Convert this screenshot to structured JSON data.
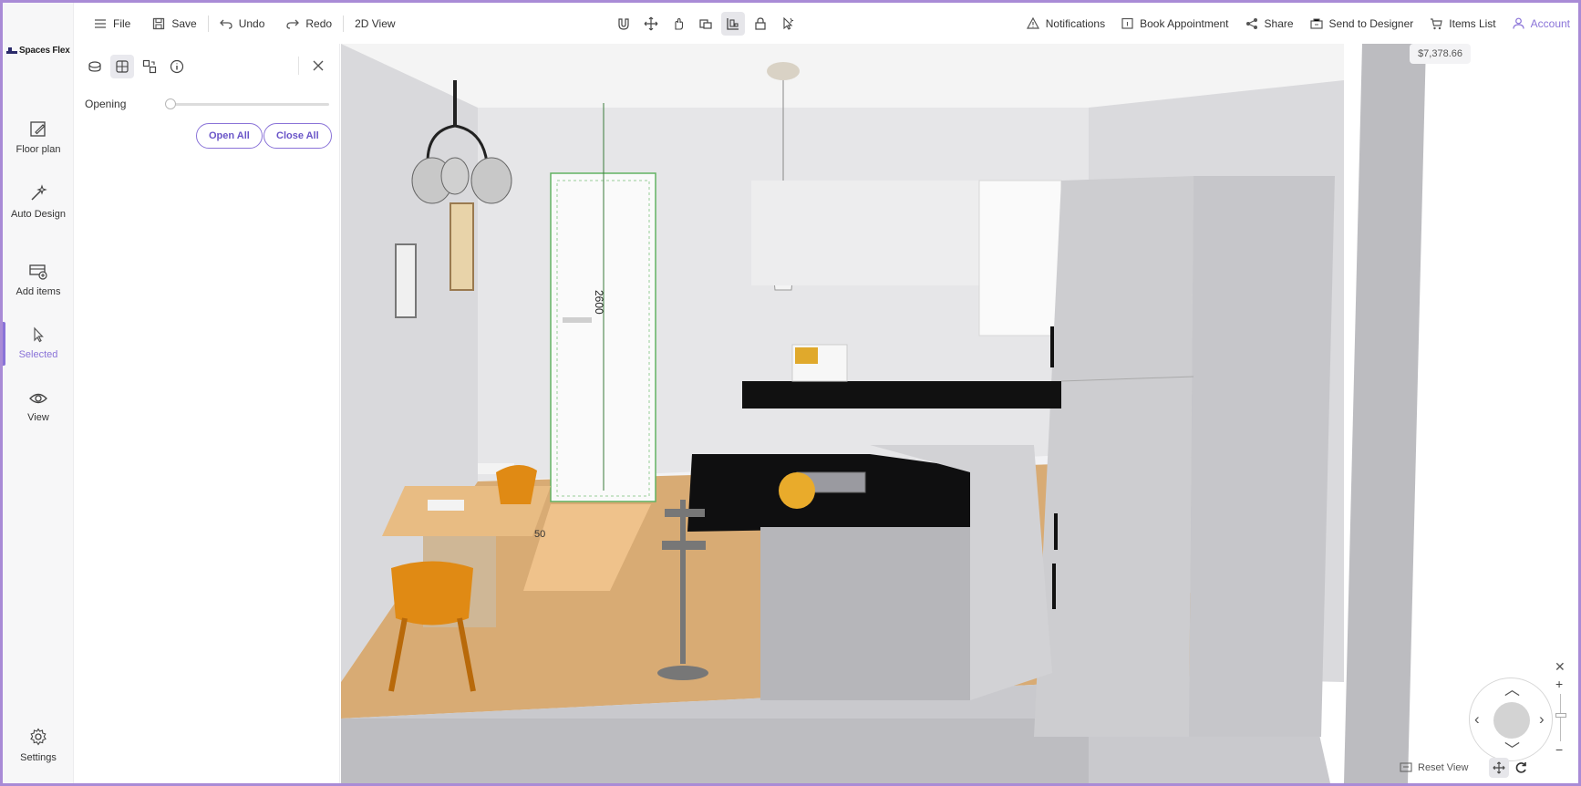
{
  "brand": {
    "name": "Spaces Flex"
  },
  "toolbar": {
    "file": "File",
    "save": "Save",
    "undo": "Undo",
    "redo": "Redo",
    "view_2d": "2D View",
    "notifications": "Notifications",
    "book_appointment": "Book Appointment",
    "share": "Share",
    "send_to_designer": "Send to Designer",
    "items_list": "Items List",
    "account": "Account"
  },
  "sidebar": {
    "items": [
      {
        "label": "Floor plan",
        "icon": "floor-plan-icon"
      },
      {
        "label": "Auto Design",
        "icon": "magic-wand-icon"
      },
      {
        "label": "Add items",
        "icon": "add-items-icon"
      },
      {
        "label": "Selected",
        "icon": "cursor-icon",
        "active": true
      },
      {
        "label": "View",
        "icon": "eye-icon"
      }
    ],
    "settings": "Settings"
  },
  "panel": {
    "opening_label": "Opening",
    "opening_value": 0,
    "open_all": "Open All",
    "close_all": "Close All"
  },
  "viewport": {
    "price": "$7,378.66",
    "dimension_height": "2600",
    "dimension_width": "50",
    "reset_view": "Reset View"
  },
  "colors": {
    "accent": "#8a73d8",
    "border": "#a98bd6",
    "countertop": "#111111",
    "floor": "#d6a871",
    "chair": "#e08a14"
  }
}
